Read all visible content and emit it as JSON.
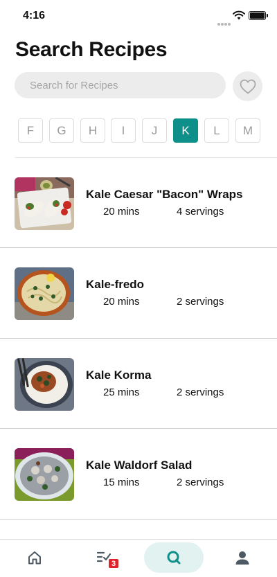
{
  "status_bar": {
    "time": "4:16"
  },
  "page": {
    "title": "Search Recipes"
  },
  "search": {
    "placeholder": "Search for Recipes"
  },
  "alphabet": {
    "letters": [
      "F",
      "G",
      "H",
      "I",
      "J",
      "K",
      "L",
      "M"
    ],
    "selected": "K",
    "accent_color": "#0f8f8a"
  },
  "recipes": [
    {
      "name": "Kale Caesar \"Bacon\" Wraps",
      "time": "20 mins",
      "servings": "4 servings"
    },
    {
      "name": "Kale-fredo",
      "time": "20 mins",
      "servings": "2 servings"
    },
    {
      "name": "Kale Korma",
      "time": "25 mins",
      "servings": "2 servings"
    },
    {
      "name": "Kale Waldorf Salad",
      "time": "15 mins",
      "servings": "2 servings"
    }
  ],
  "tab_bar": {
    "tabs": [
      {
        "icon": "home-icon"
      },
      {
        "icon": "checklist-icon",
        "badge": "3"
      },
      {
        "icon": "search-icon",
        "active": true
      },
      {
        "icon": "person-icon"
      }
    ]
  }
}
